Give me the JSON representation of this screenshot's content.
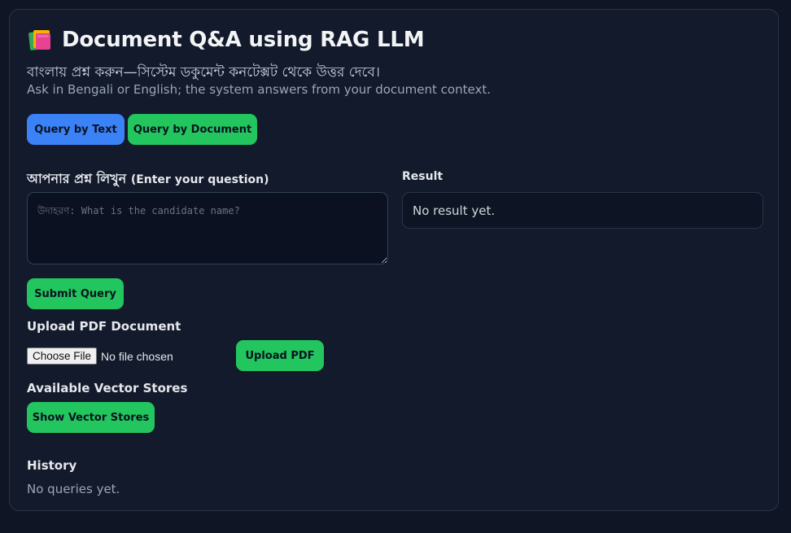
{
  "header": {
    "title": "Document Q&A using RAG LLM",
    "title_icon": "books-icon",
    "subtitle_bn": "বাংলায় প্রশ্ন করুন—সিস্টেম ডকুমেন্ট কনটেক্সট থেকে উত্তর দেবে।",
    "subtitle_en": "Ask in Bengali or English; the system answers from your document context."
  },
  "mode_tabs": {
    "text_label": "Query by Text",
    "document_label": "Query by Document"
  },
  "question": {
    "label_bn": "আপনার প্রশ্ন লিখুন",
    "label_en": "(Enter your question)",
    "placeholder": "উদাহরণ: What is the candidate name?",
    "value": ""
  },
  "result": {
    "label": "Result",
    "text": "No result yet."
  },
  "actions": {
    "submit_label": "Submit Query"
  },
  "upload": {
    "label": "Upload PDF Document",
    "choose_label": "Choose File",
    "file_status": "No file chosen",
    "upload_label": "Upload PDF"
  },
  "vector_stores": {
    "label": "Available Vector Stores",
    "show_label": "Show Vector Stores"
  },
  "history": {
    "label": "History",
    "empty_text": "No queries yet."
  },
  "colors": {
    "background": "#0f1524",
    "panel": "#121a2b",
    "accent_blue": "#3b82f6",
    "accent_green": "#22c55e"
  }
}
